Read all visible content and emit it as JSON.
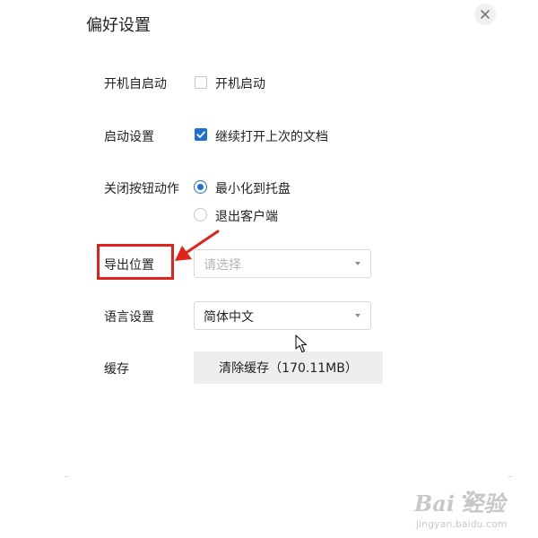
{
  "dialog": {
    "title": "偏好设置",
    "close_icon": "close-icon"
  },
  "settings": {
    "autostart": {
      "label": "开机自启动",
      "option_label": "开机启动",
      "checked": false
    },
    "startup": {
      "label": "启动设置",
      "option_label": "继续打开上次的文档",
      "checked": true
    },
    "close_action": {
      "label": "关闭按钮动作",
      "options": [
        {
          "label": "最小化到托盘",
          "selected": true
        },
        {
          "label": "退出客户端",
          "selected": false
        }
      ]
    },
    "export_location": {
      "label": "导出位置",
      "placeholder": "请选择"
    },
    "language": {
      "label": "语言设置",
      "value": "简体中文"
    },
    "cache": {
      "label": "缓存",
      "button_label": "清除缓存（170.11MB）"
    }
  },
  "watermark": {
    "logo_text": "Bai  经验",
    "url": "jingyan.baidu.com"
  },
  "colors": {
    "accent": "#1f6fd1",
    "annotation_red": "#e0231b",
    "button_bg": "#eeeeee"
  }
}
